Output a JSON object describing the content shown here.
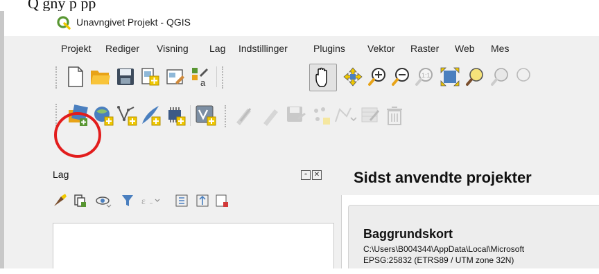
{
  "page_top_text": "Q             gny    p    pp",
  "window": {
    "title": "Unavngivet Projekt - QGIS"
  },
  "menu": [
    {
      "label": "Projekt"
    },
    {
      "label": "Rediger"
    },
    {
      "label": "Visning"
    },
    {
      "label": "Lag"
    },
    {
      "label": "Indstillinger"
    },
    {
      "label": "Plugins"
    },
    {
      "label": "Vektor"
    },
    {
      "label": "Raster"
    },
    {
      "label": "Web"
    },
    {
      "label": "Mes"
    }
  ],
  "layers_panel": {
    "title": "Lag"
  },
  "recent": {
    "title": "Sidst anvendte projekter",
    "items": [
      {
        "name": "Baggrundskort",
        "path": "C:\\Users\\B004344\\AppData\\Local\\Microsoft",
        "crs": "EPSG:25832 (ETRS89 / UTM zone 32N)"
      }
    ]
  },
  "colors": {
    "highlight_circle": "#e21d1d",
    "qgis_green": "#589632",
    "qgis_yellow": "#f0c800"
  }
}
